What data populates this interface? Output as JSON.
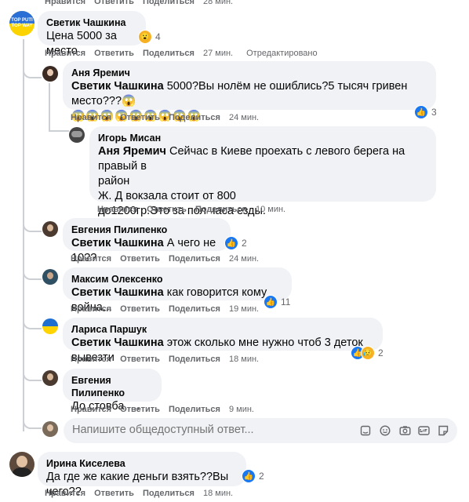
{
  "top_actions": {
    "like": "Нравится",
    "reply": "Ответить",
    "share": "Поделиться",
    "time": "28 мин."
  },
  "comments": [
    {
      "name": "Светик Чашкина",
      "text": "Цена 5000 за место",
      "emoji": "😮",
      "count": "4",
      "actions": {
        "like": "Нравится",
        "reply": "Ответить",
        "share": "Поделиться",
        "time": "27 мин.",
        "edited": "Отредактировано"
      }
    },
    {
      "name": "Аня Яремич",
      "mention": "Светик Чашкина",
      "text": " 5000?Вы нолём не ошиблись?5 тысяч гривен место???😱",
      "emoji_line": "😱😱😱😱😱😱😱😱😱",
      "count": "3",
      "actions": {
        "like": "Нравится",
        "reply": "Ответить",
        "share": "Поделиться",
        "time": "24 мин."
      }
    },
    {
      "name": "Игорь Мисан",
      "mention": "Аня Яремич",
      "line1": " Сейчас в Киеве проехать с левого берега на правый в",
      "line2": "район",
      "line3": "Ж. Д вокзала стоит от 800",
      "line4": "до1200гр.Это за пол часа езды.",
      "actions": {
        "like": "Нравится",
        "reply": "Ответить",
        "share": "Поделиться",
        "time": "10 мин."
      }
    },
    {
      "name": "Евгения Пилипенко",
      "mention": "Светик Чашкина",
      "text": " А чего не 10??",
      "count": "2",
      "actions": {
        "like": "Нравится",
        "reply": "Ответить",
        "share": "Поделиться",
        "time": "24 мин."
      }
    },
    {
      "name": "Максим Олексенко",
      "mention": "Светик Чашкина",
      "text": " как говорится кому война...",
      "count": "11",
      "actions": {
        "like": "Нравится",
        "reply": "Ответить",
        "share": "Поделиться",
        "time": "19 мин."
      }
    },
    {
      "name": "Лариса Паршук",
      "mention": "Светик Чашкина",
      "text": " этож сколько мне нужно чтоб 3 деток вывезти",
      "count": "2",
      "actions": {
        "like": "Нравится",
        "reply": "Ответить",
        "share": "Поделиться",
        "time": "18 мин."
      }
    },
    {
      "name": "Евгения Пилипенко",
      "text": "До стовба.....",
      "actions": {
        "like": "Нравится",
        "reply": "Ответить",
        "share": "Поделиться",
        "time": "9 мин."
      }
    },
    {
      "name": "Ирина Киселева",
      "text": "Да где же какие деньги взять??Вы чего??",
      "count": "2",
      "actions": {
        "like": "Нравится",
        "reply": "Ответить",
        "share": "Поделиться",
        "time": "18 мин."
      }
    }
  ],
  "reply_input": {
    "placeholder": "Напишите общедоступный ответ..."
  },
  "avatar0_text": {
    "l1": "TOP PUTI",
    "l2": "TOP WAY"
  },
  "colors": {
    "like": "#1877f2",
    "bubble": "#f0f2f5",
    "meta": "#65676b"
  },
  "icons": [
    "like-icon",
    "wow-icon",
    "sad-icon",
    "sticker-icon",
    "emoji-icon",
    "camera-icon",
    "gif-icon",
    "sticker-square-icon"
  ]
}
